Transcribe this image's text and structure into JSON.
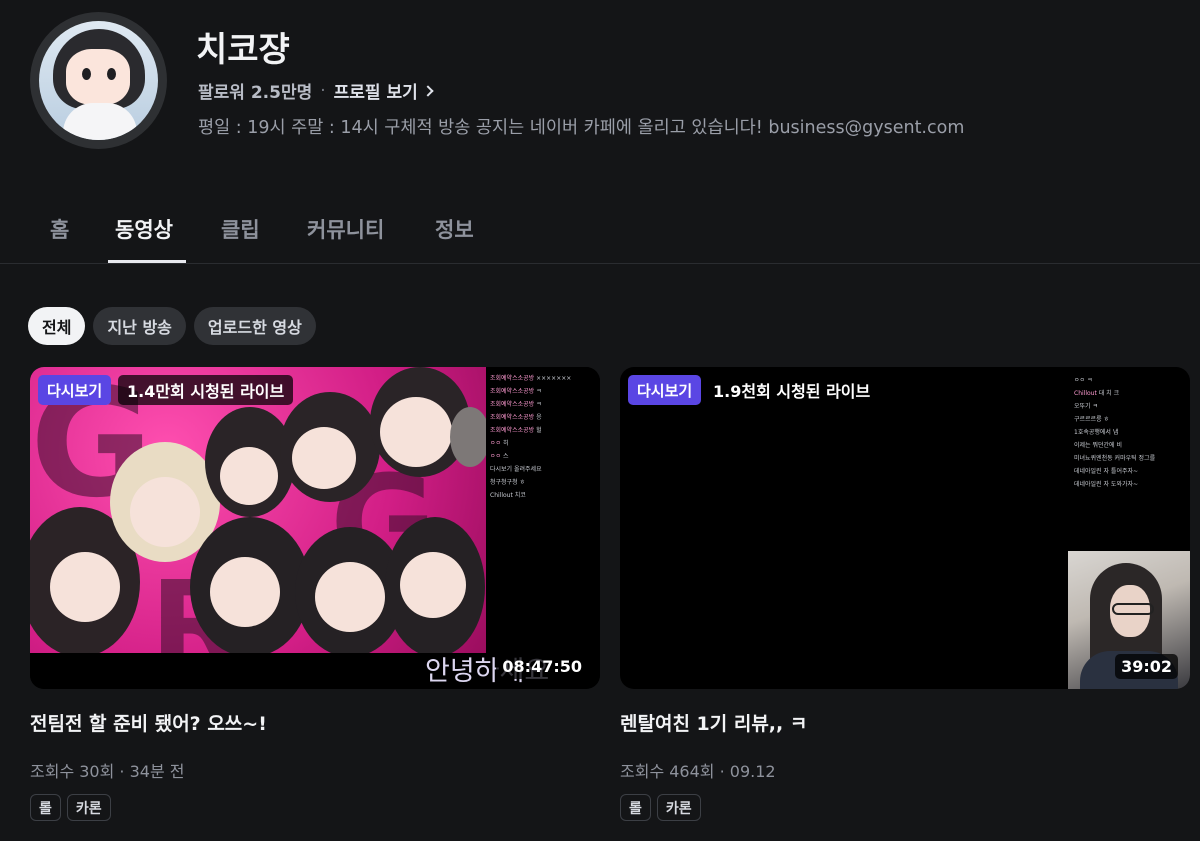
{
  "channel": {
    "name": "치코쟝",
    "followers": "팔로워 2.5만명",
    "separator": "·",
    "profile_link": "프로필 보기",
    "description": "평일 : 19시 주말 : 14시 구체적 방송 공지는 네이버 카페에 올리고 있습니다! business@gysent.com"
  },
  "tabs": [
    {
      "label": "홈",
      "active": false
    },
    {
      "label": "동영상",
      "active": true
    },
    {
      "label": "클립",
      "active": false
    },
    {
      "label": "커뮤니티",
      "active": false
    },
    {
      "label": "정보",
      "active": false
    }
  ],
  "filters": [
    {
      "label": "전체",
      "active": true
    },
    {
      "label": "지난 방송",
      "active": false
    },
    {
      "label": "업로드한 영상",
      "active": false
    }
  ],
  "videos": [
    {
      "badge": "다시보기",
      "live_views": "1.4만회 시청된 라이브",
      "duration": "08:47:50",
      "overlay_text": "안녕하세요",
      "title": "전팀전 할 준비 됐어? 오쓰~!",
      "stats": "조회수 30회 · 34분 전",
      "tags": [
        "롤",
        "카론"
      ]
    },
    {
      "badge": "다시보기",
      "live_views": "1.9천회 시청된 라이브",
      "duration": "39:02",
      "title": "렌탈여친 1기 리뷰,, ㅋ",
      "stats": "조회수 464회 · 09.12",
      "tags": [
        "롤",
        "카론"
      ]
    }
  ],
  "colors": {
    "background": "#141517",
    "replay_badge": "#5a46e4",
    "active_chip": "#f2f3f5"
  }
}
